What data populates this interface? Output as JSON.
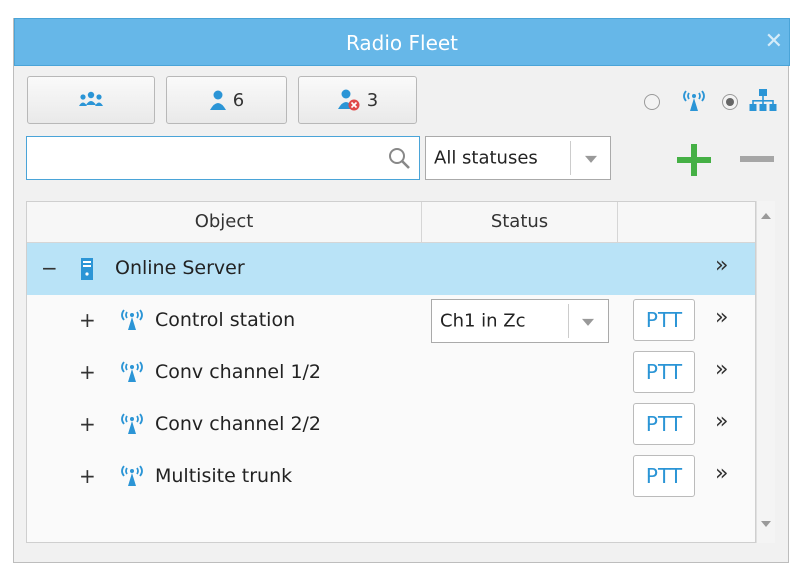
{
  "window": {
    "title": "Radio Fleet",
    "close_glyph": "✕"
  },
  "toolbar": {
    "buttons": [
      {
        "icon": "group-icon",
        "count": ""
      },
      {
        "icon": "user-icon",
        "count": "6"
      },
      {
        "icon": "user-offline-icon",
        "count": "3"
      }
    ],
    "view_mode": {
      "options": [
        "radio-icon",
        "hierarchy-icon"
      ],
      "selected": "hierarchy-icon"
    }
  },
  "filter": {
    "search_value": "",
    "search_placeholder": "",
    "status_select": "All statuses"
  },
  "actions": {
    "add": "+",
    "remove": "−"
  },
  "table": {
    "columns": [
      "Object",
      "Status",
      ""
    ],
    "rows": [
      {
        "expander": "−",
        "icon": "server-icon",
        "label": "Online Server",
        "status": "",
        "ptt": "",
        "more": "»",
        "selected": true
      },
      {
        "expander": "+",
        "icon": "antenna-icon",
        "label": "Control station",
        "status": "Ch1 in Zc",
        "ptt": "PTT",
        "more": "»"
      },
      {
        "expander": "+",
        "icon": "antenna-icon",
        "label": "Conv channel 1/2",
        "status": "",
        "ptt": "PTT",
        "more": "»"
      },
      {
        "expander": "+",
        "icon": "antenna-icon",
        "label": "Conv channel 2/2",
        "status": "",
        "ptt": "PTT",
        "more": "»"
      },
      {
        "expander": "+",
        "icon": "antenna-icon",
        "label": "Multisite trunk",
        "status": "",
        "ptt": "PTT",
        "more": "»"
      }
    ]
  },
  "colors": {
    "titlebar": "#66b7e8",
    "accent": "#2b95d6",
    "selection": "#b9e3f7",
    "add_green": "#45b045",
    "offline_red": "#e04848"
  }
}
